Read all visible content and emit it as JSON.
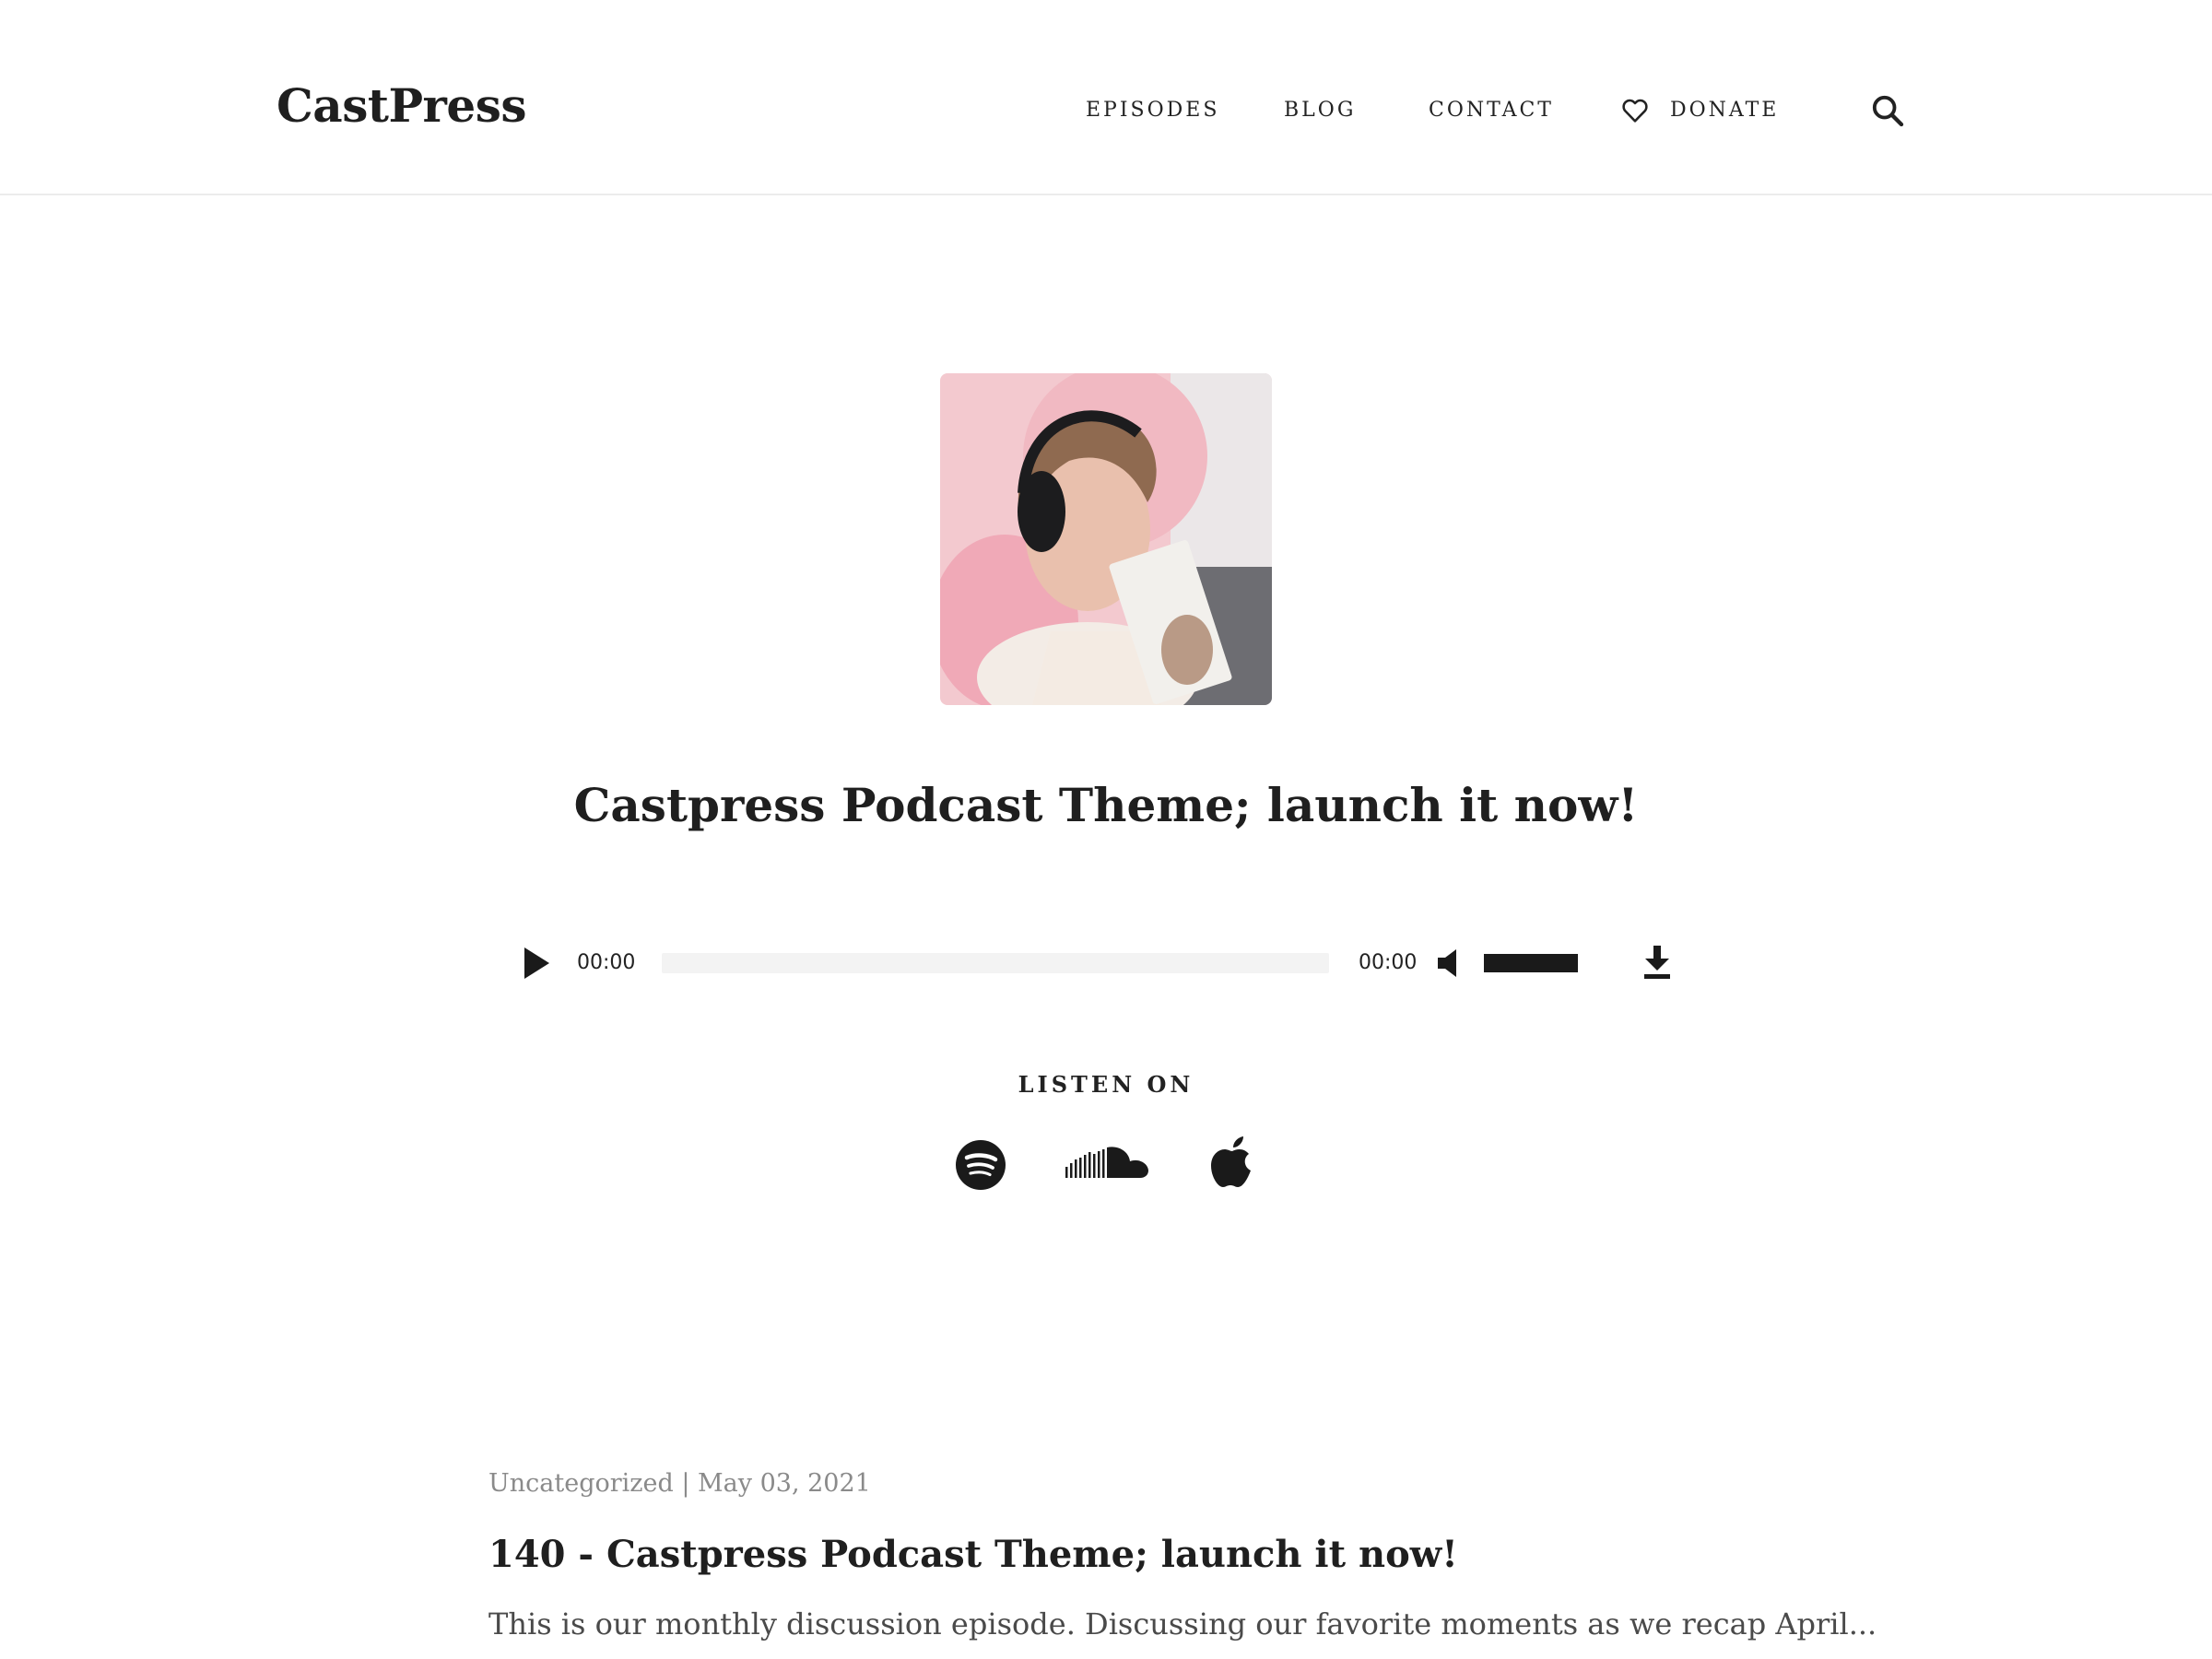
{
  "header": {
    "logo": "CastPress",
    "nav": {
      "episodes": "EPISODES",
      "blog": "BLOG",
      "contact": "CONTACT",
      "donate": "DONATE"
    }
  },
  "hero": {
    "title": "Castpress Podcast Theme; launch it now!"
  },
  "player": {
    "current_time": "00:00",
    "duration": "00:00",
    "progress": 0,
    "volume": 1.0
  },
  "listen": {
    "label": "LISTEN ON",
    "platforms": [
      "spotify-icon",
      "soundcloud-icon",
      "apple-icon"
    ]
  },
  "post": {
    "category": "Uncategorized",
    "separator": " | ",
    "date": "May 03, 2021",
    "title": "140 - Castpress Podcast Theme; launch it now!",
    "excerpt": "This is our monthly discussion episode. Discussing our favorite moments as we recap April..."
  },
  "colors": {
    "text": "#222222",
    "muted": "#8a8a8a",
    "border": "#ececec",
    "cover_bg": "#f3c9cf"
  }
}
